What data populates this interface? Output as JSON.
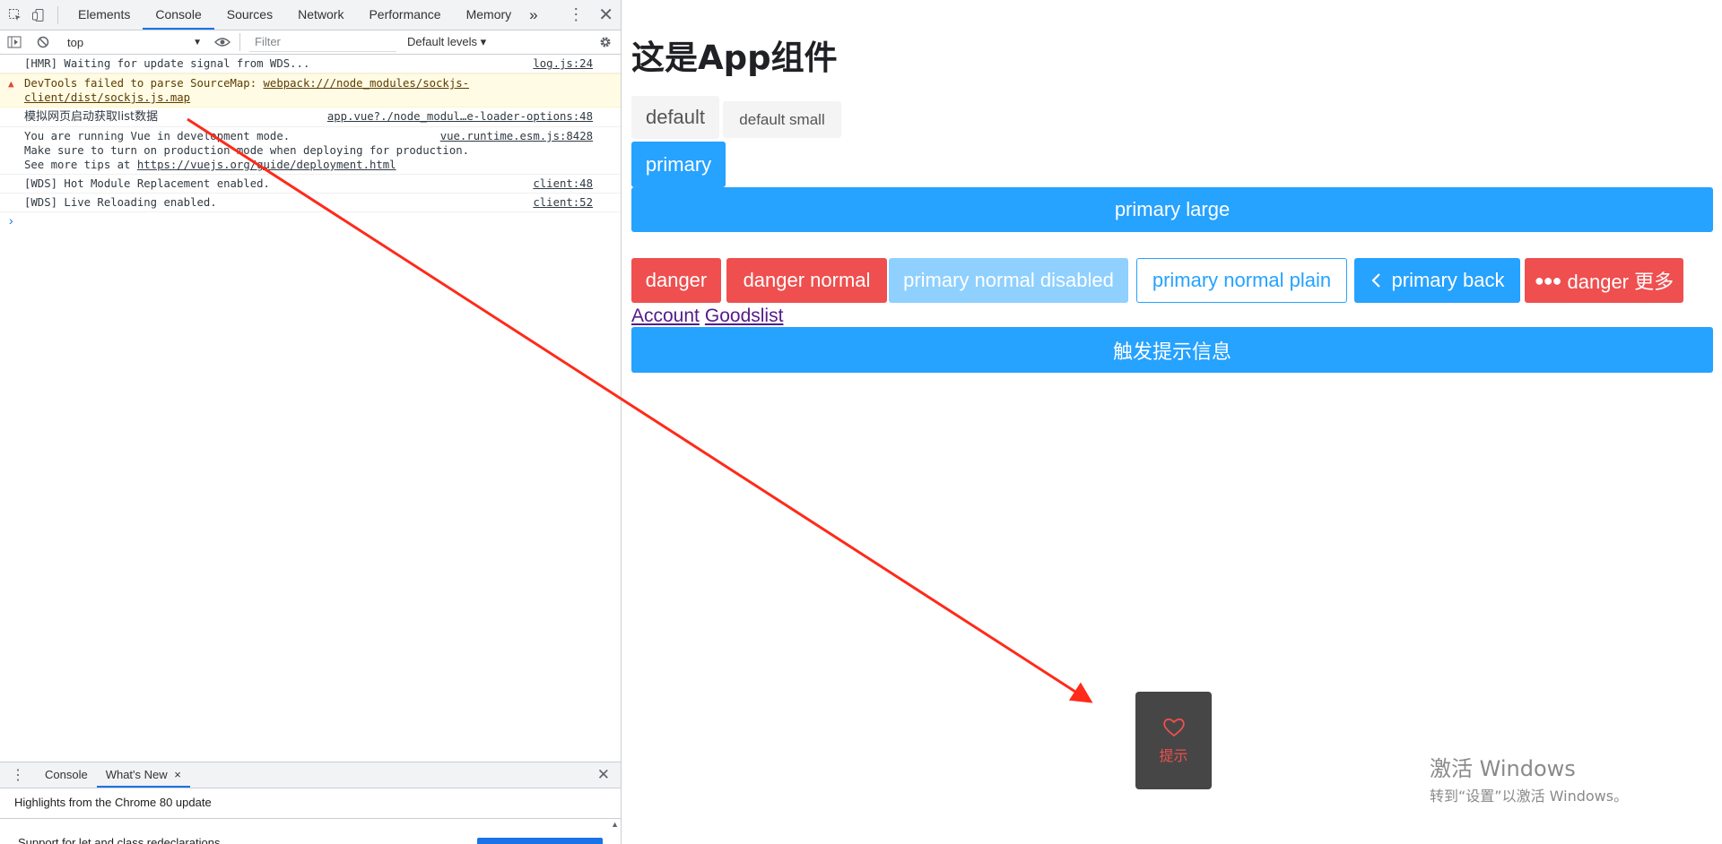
{
  "devtools": {
    "tabs": [
      "Elements",
      "Console",
      "Sources",
      "Network",
      "Performance",
      "Memory"
    ],
    "more_tabs": "»",
    "toolbar": {
      "context": "top",
      "filter_placeholder": "Filter",
      "levels": "Default levels ▾"
    },
    "console": {
      "lines": [
        {
          "text": "[HMR] Waiting for update signal from WDS...",
          "source": "log.js:24"
        },
        {
          "text_prefix": "DevTools failed to parse SourceMap: ",
          "link": "webpack:///node_modules/sockjs-client/dist/sockjs.js.map"
        },
        {
          "text": "模拟网页启动获取list数据",
          "source": "app.vue?./node_modul…e-loader-options:48"
        },
        {
          "line1": "You are running Vue in development mode.",
          "line2": "Make sure to turn on production mode when deploying for production.",
          "line3_prefix": "See more tips at ",
          "line3_link": "https://vuejs.org/guide/deployment.html",
          "source": "vue.runtime.esm.js:8428"
        },
        {
          "text": "[WDS] Hot Module Replacement enabled.",
          "source": "client:48"
        },
        {
          "text": "[WDS] Live Reloading enabled.",
          "source": "client:52"
        }
      ],
      "prompt": "›"
    },
    "drawer": {
      "tabs": [
        "Console",
        "What's New"
      ],
      "close_x": "×",
      "heading": "Highlights from the Chrome 80 update",
      "cut_text": "Support for let and class redeclarations"
    }
  },
  "app": {
    "title": "这是App组件",
    "buttons": {
      "default": "default",
      "default_small": "default small",
      "primary": "primary",
      "primary_large": "primary large",
      "danger": "danger",
      "danger_normal": "danger normal",
      "primary_normal_disabled": "primary normal disabled",
      "primary_normal_plain": "primary normal plain",
      "primary_back": "primary back",
      "danger_more": "danger 更多",
      "trigger": "触发提示信息"
    },
    "links": {
      "account": "Account",
      "goodslist": "Goodslist"
    },
    "toast": {
      "text": "提示",
      "icon": "heart-outline-icon"
    }
  },
  "watermark": {
    "line1": "激活 Windows",
    "line2": "转到“设置”以激活 Windows。"
  },
  "colors": {
    "primary": "#26a2ff",
    "danger": "#ef4f4f",
    "disabled": "#8fd0ff",
    "arrow": "#ff2a1a"
  }
}
